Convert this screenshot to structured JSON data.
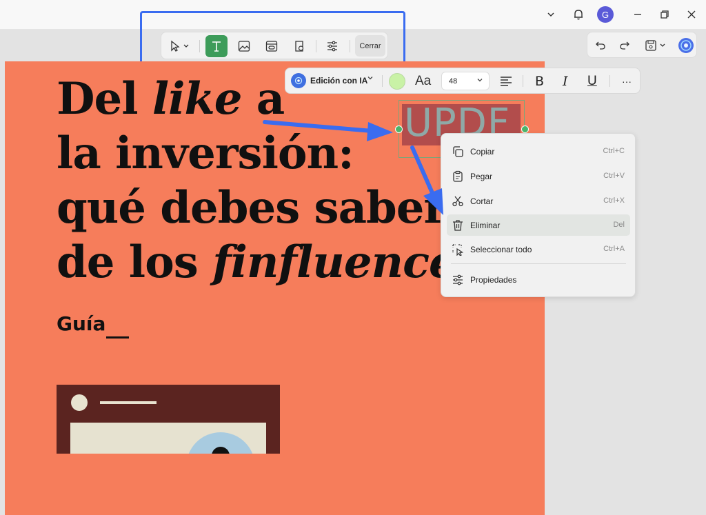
{
  "toolbar": {
    "close_label": "Cerrar"
  },
  "titlebar": {
    "avatar_letter": "G"
  },
  "document": {
    "headline": {
      "line1_a": "Del ",
      "line1_b": "like",
      "line1_c": " a",
      "line2": "la inversión:",
      "line3": "qué debes saber",
      "line4_a": "de los ",
      "line4_b": "finfluencers"
    },
    "subtitle": "Guía",
    "selected_text": "UPDF"
  },
  "format_bar": {
    "ai_label": "Edición con IA",
    "font_icon": "Aa",
    "font_size": "48",
    "bold": "B",
    "italic": "I",
    "underline": "U",
    "more": "···",
    "text_color": "#c9f2a6"
  },
  "context_menu": {
    "items": [
      {
        "label": "Copiar",
        "shortcut": "Ctrl+C",
        "icon": "copy-icon"
      },
      {
        "label": "Pegar",
        "shortcut": "Ctrl+V",
        "icon": "paste-icon"
      },
      {
        "label": "Cortar",
        "shortcut": "Ctrl+X",
        "icon": "scissors-icon"
      },
      {
        "label": "Eliminar",
        "shortcut": "Del",
        "icon": "trash-icon"
      },
      {
        "label": "Seleccionar todo",
        "shortcut": "Ctrl+A",
        "icon": "select-all-icon"
      },
      {
        "label": "Propiedades",
        "shortcut": "",
        "icon": "sliders-icon"
      }
    ]
  },
  "colors": {
    "accent_green": "#3d9c5a",
    "annotation_blue": "#3a6cf0",
    "page_orange": "#f67d5b"
  }
}
